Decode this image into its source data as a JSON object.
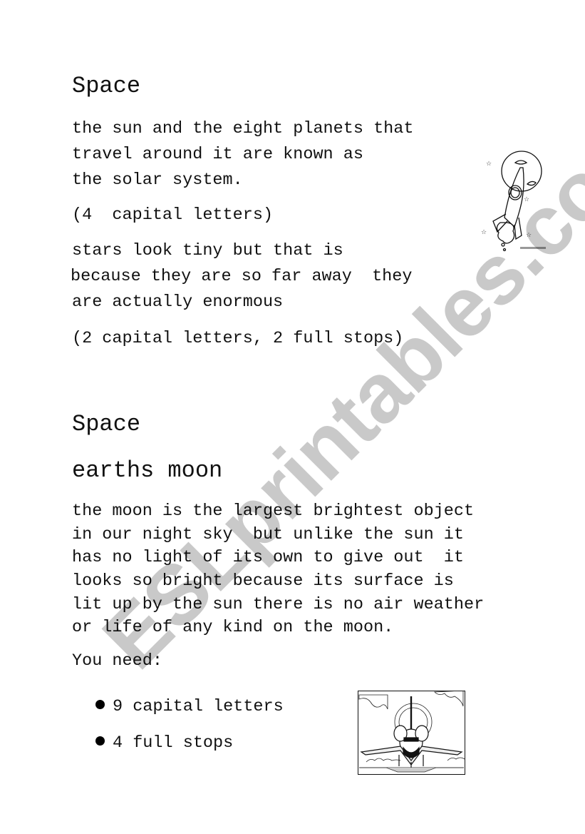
{
  "section1": {
    "title": "Space",
    "paragraph1_lines": [
      "the sun and the eight planets that",
      "travel around it are known as",
      "the solar system."
    ],
    "note1": "(4  capital letters)",
    "paragraph2_lines": [
      "stars look tiny but that is",
      "because they are so far away  they",
      "are actually enormous"
    ],
    "note2": "(2 capital letters, 2 full stops)",
    "image": "rocket-moon-illustration"
  },
  "section2": {
    "title": "Space",
    "subtitle": "earths moon",
    "paragraph_lines": [
      "the moon is the largest brightest object",
      "in our night sky  but unlike the sun it",
      "has no light of its own to give out  it",
      "looks so bright because its surface is",
      "lit up by the sun there is no air weather",
      "or life of any kind on the moon."
    ],
    "you_need_label": "You need:",
    "requirements": [
      "9 capital letters",
      "4 full stops"
    ],
    "image": "space-shuttle-illustration"
  },
  "watermark": "ESLprintables.com"
}
